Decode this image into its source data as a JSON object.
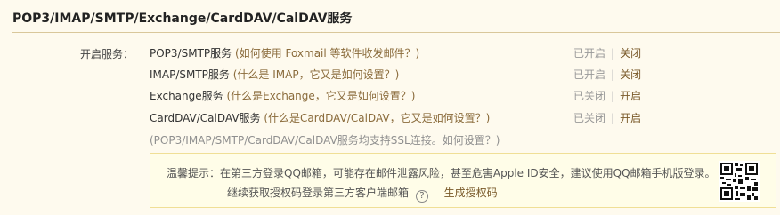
{
  "section": {
    "title": "POP3/IMAP/SMTP/Exchange/CardDAV/CalDAV服务",
    "service_label": "开启服务："
  },
  "services": [
    {
      "name": "POP3/SMTP服务",
      "hint": "(如何使用 Foxmail 等软件收发邮件？)",
      "status": "已开启",
      "action": "关闭"
    },
    {
      "name": "IMAP/SMTP服务",
      "hint": "(什么是 IMAP，它又是如何设置？)",
      "status": "已开启",
      "action": "关闭"
    },
    {
      "name": "Exchange服务",
      "hint": "(什么是Exchange，它又是如何设置？)",
      "status": "已关闭",
      "action": "开启"
    },
    {
      "name": "CardDAV/CalDAV服务",
      "hint": "(什么是CardDAV/CalDAV，它又是如何设置？)",
      "status": "已关闭",
      "action": "开启"
    }
  ],
  "separator": "|",
  "ssl_note": "(POP3/IMAP/SMTP/CardDAV/CalDAV服务均支持SSL连接。如何设置？)",
  "tip": {
    "line1": "温馨提示：在第三方登录QQ邮箱，可能存在邮件泄露风险，甚至危害Apple ID安全，建议使用QQ邮箱手机版登录。",
    "line2": "继续获取授权码登录第三方客户端邮箱",
    "help_icon": "?",
    "generate_label": "生成授权码"
  }
}
